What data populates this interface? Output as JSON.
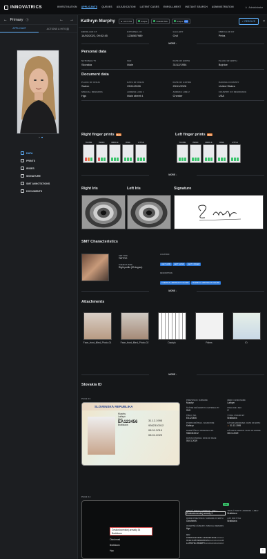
{
  "app": {
    "brand": "INNOVATRICS",
    "nav": [
      "INVESTIGATION",
      "APPLICANTS",
      "QUEUES",
      "ADJUDICATION",
      "LATENT CASES",
      "ENROLLMENT",
      "INSTANT SEARCH",
      "ADMINISTRATION"
    ],
    "active_nav": "APPLICANTS",
    "user": "Administrator"
  },
  "sidebar": {
    "title": "Primary",
    "tabs": [
      "APPLICANT",
      "ACTIONS & HITS"
    ],
    "hits_count": "3",
    "menu": [
      "DATA",
      "PRINTS",
      "IRISES",
      "SIGNATURE",
      "SMT ANNOTATIONS",
      "DOCUMENTS"
    ]
  },
  "header": {
    "name": "Kathryn Murphy",
    "chip1": "LIST 704",
    "chip2": "Unique",
    "chip3": "CLEAR IMG",
    "chip4": "Unique",
    "chip4b": "NO",
    "button": "RESOLVE"
  },
  "summary": [
    {
      "label": "ENROLLED AT",
      "value": "14/02/2021, 09:02:45"
    },
    {
      "label": "EXTERNAL ID",
      "value": "1234567989"
    },
    {
      "label": "GALLERY",
      "value": "Civil"
    },
    {
      "label": "ENROLLED BY",
      "value": "Petra"
    }
  ],
  "more": "MORE",
  "personal": {
    "title": "Personal data",
    "fields": [
      {
        "label": "NATIONALITY",
        "value": "Slovakia"
      },
      {
        "label": "SEX",
        "value": "Male"
      },
      {
        "label": "DATE OF BIRTH",
        "value": "31/12/1954"
      },
      {
        "label": "PLACE OF BIRTH",
        "value": "Bojnice"
      }
    ]
  },
  "document": {
    "title": "Document data",
    "row1": [
      {
        "label": "PLACE OF ISSUE",
        "value": "Salem"
      },
      {
        "label": "DATE OF ISSUE",
        "value": "25/11/2026"
      },
      {
        "label": "DATE OF EXPIRE",
        "value": "25/11/2026"
      },
      {
        "label": "ISSUING COUNTRY",
        "value": "United States"
      }
    ],
    "row2": [
      {
        "label": "SPECIAL REMARKS",
        "value": "Hgs"
      },
      {
        "label": "ADRESS LINE 1",
        "value": "Main street 4"
      },
      {
        "label": "ADRESS LINE 2",
        "value": "Chester"
      },
      {
        "label": "COUNTRY OF RESIDENCE",
        "value": "USA"
      }
    ]
  },
  "prints": {
    "right_title": "Right finger prints",
    "left_title": "Left finger prints",
    "badge": "New",
    "fingers": [
      "THUMB",
      "INDEX",
      "MIDDLE",
      "RING",
      "LITTLE"
    ]
  },
  "irises": {
    "right": "Right Iris",
    "left": "Left Iris",
    "signature": "Signature"
  },
  "smt": {
    "title": "SMT Characteristics",
    "smt_type_label": "SMT TYPE",
    "smt_type": "TATTOO",
    "location_label": "LOCATION",
    "locations": [
      "LEFT ARM",
      "LEFT HAND",
      "LEFT FINGER"
    ],
    "subject_pose_label": "SUBJECT POSE",
    "subject_pose": "Right profile (90 degree)",
    "description_label": "DESCRIPTION",
    "descriptions": [
      "CHEMICAL ABSTRACT FIGURE",
      "CHEMICAL ABSTRACT FIGURE"
    ]
  },
  "attachments": {
    "title": "Attachments",
    "items": [
      "Face_front_filled_Photo-01",
      "Face_front_filled_Photo-02",
      "Dactylo",
      "Palms",
      "ID"
    ]
  },
  "slovak_id": {
    "title": "Slovakia ID",
    "page1": "PAGE 01",
    "page2": "PAGE 14",
    "card": {
      "header": "SLOVENSKÁ REPUBLIKA",
      "surname": "Murphy",
      "name": "Lathryn",
      "sex": "SVK",
      "number": "EA123456",
      "city": "Bratislava",
      "date1": "31.12.1995",
      "id": "9362310012",
      "date2": "08.01.2019",
      "date3": "08.01.2029"
    },
    "fields": [
      {
        "k": "PRIEZVISKO / SURNAME",
        "v": "Murphy"
      },
      {
        "k": "MENO / GIVEN NAME",
        "v": "Lathryn"
      },
      {
        "k": "ŠTÁTNE OBČIANSTVO / NATIONALITY",
        "v": "SVK"
      },
      {
        "k": "POHLAVIE / SEX",
        "v": "Z"
      },
      {
        "k": "ČÍSLO / NO.",
        "v": "EA123456"
      },
      {
        "k": "VYDAL / ISSUED BY",
        "v": "Bratislava"
      },
      {
        "k": "PODPIS DRŽITEĽA / SIGNATURE",
        "v": "Kathryn"
      },
      {
        "k": "DÁTUM NARODENIA / DATE OF BIRTH",
        "v": "31.12.1995"
      },
      {
        "k": "RODNÉ ČÍSLO / PERSONAL NO.",
        "v": "9362310012"
      },
      {
        "k": "DÁTUM PLATNOSTI / DATE OF EXPIRE",
        "v": "08.01.2029"
      },
      {
        "k": "DÁTUM VYDANIA / DATE OF ISSUE",
        "v": "08.01.2019"
      }
    ],
    "back": {
      "highlight": "Československej armády 34\nBratislava",
      "f1": "Okruhmeš",
      "f2": "Bratislava",
      "f3": "Hgs",
      "fields": [
        {
          "k": "TRVALÝ POBYT / ADDRESS - LINE 1",
          "v": "Československej armády 3"
        },
        {
          "k": "TRVALÝ POBYT / ADDRESS - LINE 2",
          "v": "Bratislava"
        },
        {
          "k": "RODNÉ PRIEZVISKO / SURNAME AT BIRTH",
          "v": "Okruhmeš"
        },
        {
          "k": "LIST FOR TITLE",
          "v": "Bratislava"
        },
        {
          "k": "OSOBITNÉ ZÁZNAMY / SPECIAL REMARKS",
          "v": "Hgs"
        }
      ],
      "mrz_label": "MRZ",
      "mrz": [
        "IDSVK4123456<<4393231012<<<<<<",
        "9512319F2901083SVK<<<<<<<<<<<0",
        "LATHRYN<<MURPHY<<<<<<<<<<<<<<<"
      ],
      "ok": "OK"
    }
  },
  "colors": {
    "accent": "#5fb2ff",
    "bg": "#151719",
    "panel": "#1c1e21",
    "new_badge": "#e8823b",
    "tag": "#2f7de0"
  }
}
